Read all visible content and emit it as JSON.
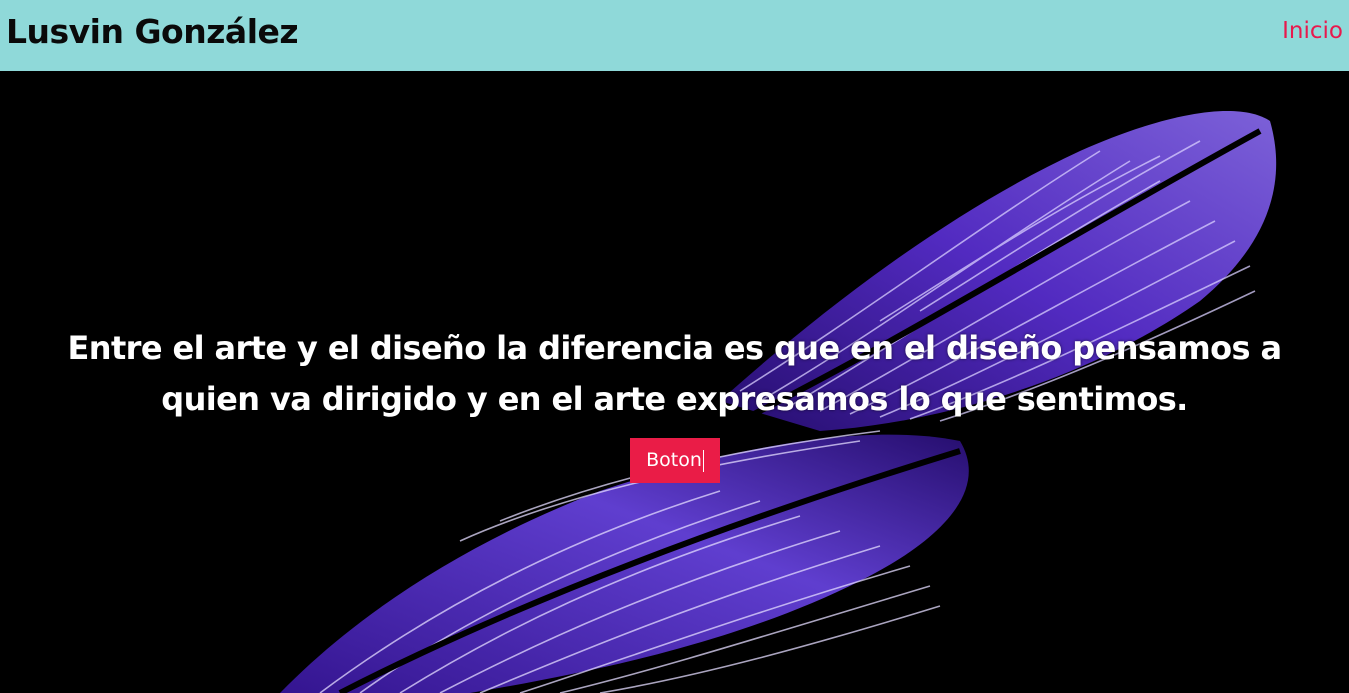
{
  "header": {
    "brand": "Lusvin González",
    "nav": [
      {
        "label": "Inicio"
      }
    ]
  },
  "hero": {
    "quote": "Entre el arte y el diseño la diferencia es que en el diseño pensamos a quien va dirigido y en el arte expresamos lo que sentimos.",
    "button_label": "Boton",
    "background": "purple-feather-image"
  },
  "colors": {
    "header_bg": "#8fd9d9",
    "accent": "#ea1c47",
    "hero_bg": "#000000",
    "feather": "#5b2fd6"
  }
}
